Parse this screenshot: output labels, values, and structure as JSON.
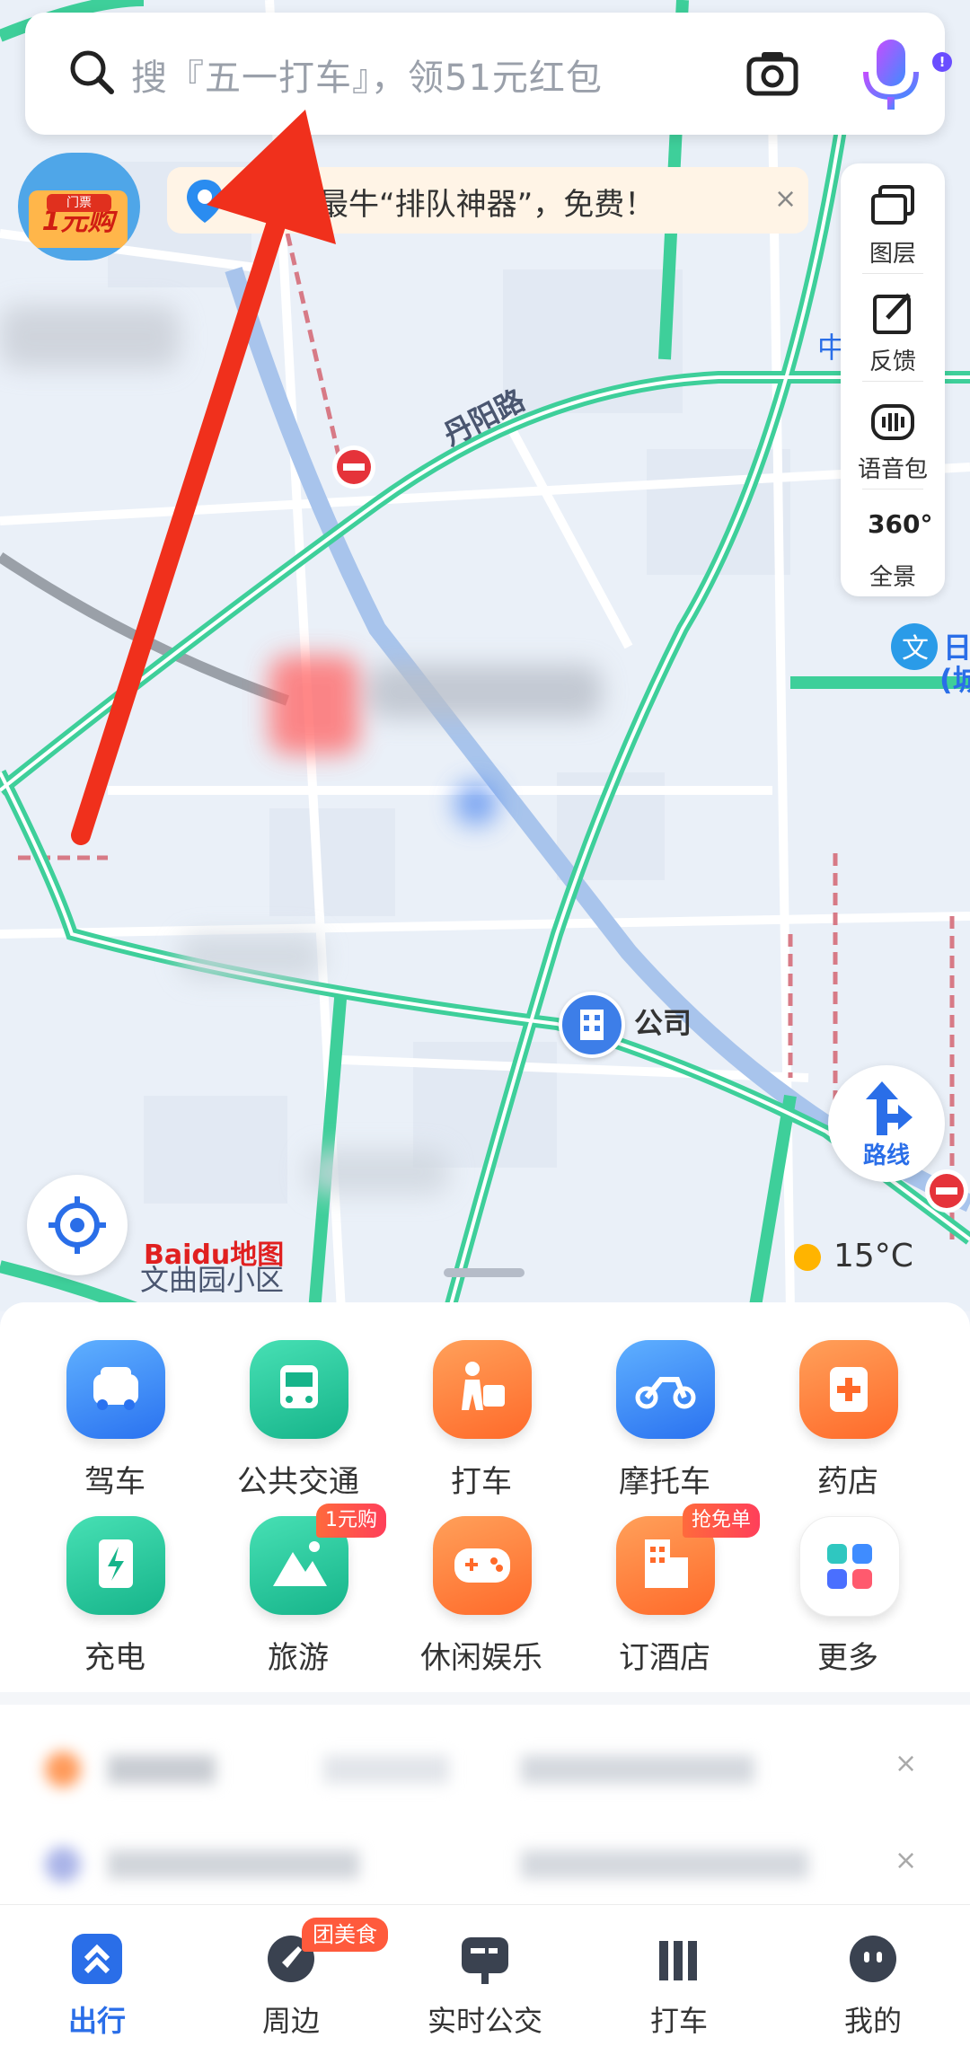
{
  "search": {
    "placeholder": "搜『五一打车』，领51元红包"
  },
  "promo_badge": {
    "tag": "门票",
    "label": "1元购"
  },
  "banner": {
    "text": "最牛“排队神器”，免费！",
    "close": "×"
  },
  "map_tools": [
    {
      "label": "图层",
      "icon": "layers-icon"
    },
    {
      "label": "反馈",
      "icon": "feedback-icon"
    },
    {
      "label": "语音包",
      "icon": "voice-pack-icon"
    },
    {
      "label": "全景",
      "icon": "panorama-360-icon"
    }
  ],
  "panorama_text": "360°",
  "map": {
    "road_name": "丹阳路",
    "poi_company": "公司",
    "area_name": "文曲园小区",
    "logo": "Baidu地图",
    "partial_label_1": "中",
    "partial_label_2": "日",
    "partial_label_3": "(城"
  },
  "route_button": {
    "label": "路线"
  },
  "weather": {
    "temperature": "15°C"
  },
  "services": [
    {
      "label": "驾车",
      "icon": "car-icon",
      "color": "blue"
    },
    {
      "label": "公共交通",
      "icon": "bus-icon",
      "color": "green"
    },
    {
      "label": "打车",
      "icon": "taxi-icon",
      "color": "orange"
    },
    {
      "label": "摩托车",
      "icon": "motorcycle-icon",
      "color": "blue"
    },
    {
      "label": "药店",
      "icon": "pharmacy-icon",
      "color": "orange"
    },
    {
      "label": "充电",
      "icon": "charging-icon",
      "color": "green"
    },
    {
      "label": "旅游",
      "icon": "travel-icon",
      "color": "green",
      "badge": "1元购"
    },
    {
      "label": "休闲娱乐",
      "icon": "gamepad-icon",
      "color": "orange"
    },
    {
      "label": "订酒店",
      "icon": "hotel-icon",
      "color": "orange",
      "badge": "抢免单"
    },
    {
      "label": "更多",
      "icon": "more-grid-icon",
      "color": "more"
    }
  ],
  "recommend_close": "×",
  "tabs": [
    {
      "label": "出行",
      "icon": "travel-tab-icon",
      "active": true
    },
    {
      "label": "周边",
      "icon": "nearby-icon",
      "badge": "团美食"
    },
    {
      "label": "实时公交",
      "icon": "realtime-bus-icon"
    },
    {
      "label": "打车",
      "icon": "taxi-tab-icon"
    },
    {
      "label": "我的",
      "icon": "profile-icon"
    }
  ],
  "colors": {
    "accent": "#2a6ee8",
    "road_green": "#3ecf9a",
    "arrow_red": "#f0301c"
  }
}
